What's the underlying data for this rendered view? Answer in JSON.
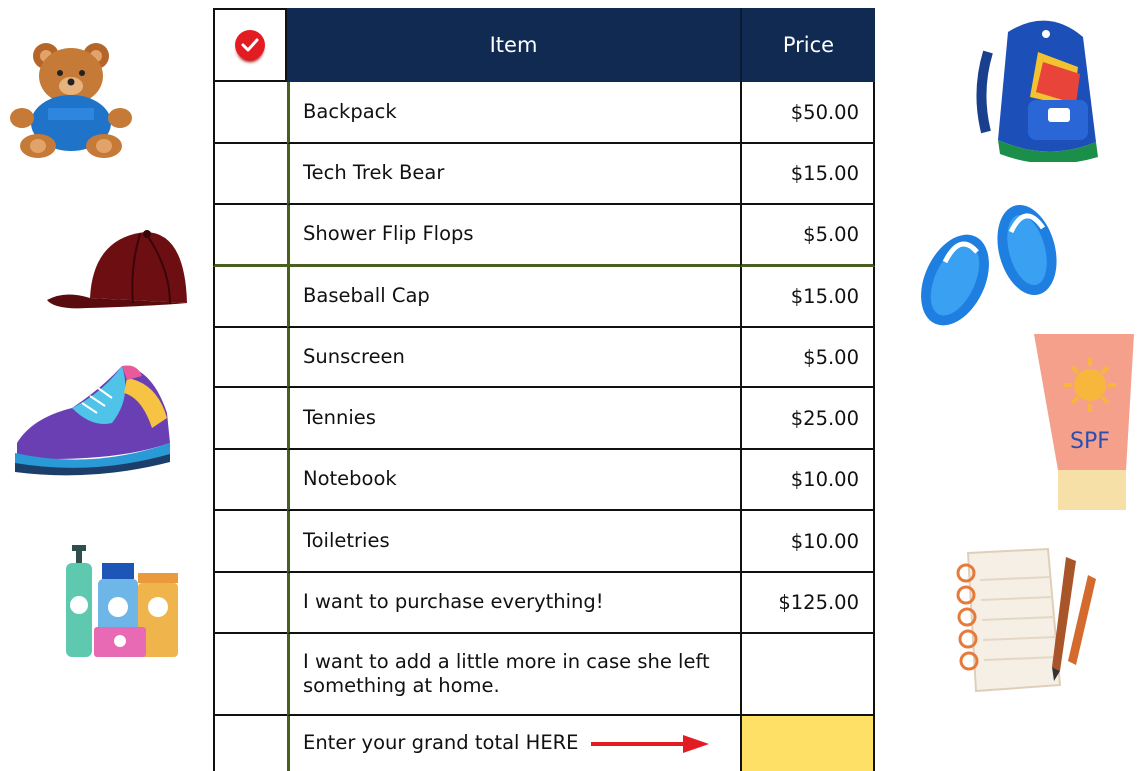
{
  "header": {
    "check_icon": "checkmark-icon",
    "item_label": "Item",
    "price_label": "Price"
  },
  "items": [
    {
      "name": "Backpack",
      "price": "$50.00"
    },
    {
      "name": "Tech Trek Bear",
      "price": "$15.00"
    },
    {
      "name": "Shower Flip Flops",
      "price": "$5.00"
    },
    {
      "name": "Baseball Cap",
      "price": "$15.00"
    },
    {
      "name": "Sunscreen",
      "price": "$5.00"
    },
    {
      "name": "Tennies",
      "price": "$25.00"
    },
    {
      "name": "Notebook",
      "price": "$10.00"
    },
    {
      "name": "Toiletries",
      "price": "$10.00"
    },
    {
      "name": "I want to purchase everything!",
      "price": "$125.00"
    },
    {
      "name": "I want to add a little more in case she left something at home.",
      "price": ""
    }
  ],
  "total": {
    "label": "Enter your grand total HERE",
    "value": ""
  },
  "colors": {
    "header_bg": "#102a52",
    "total_bg": "#ffe066",
    "accent_red": "#e31b23",
    "divider_green": "#4a5e22"
  },
  "cliparts": [
    "teddy-bear-icon",
    "baseball-cap-icon",
    "sneaker-icon",
    "toiletries-icon",
    "backpack-icon",
    "flip-flops-icon",
    "sunscreen-icon",
    "notebook-icon"
  ]
}
